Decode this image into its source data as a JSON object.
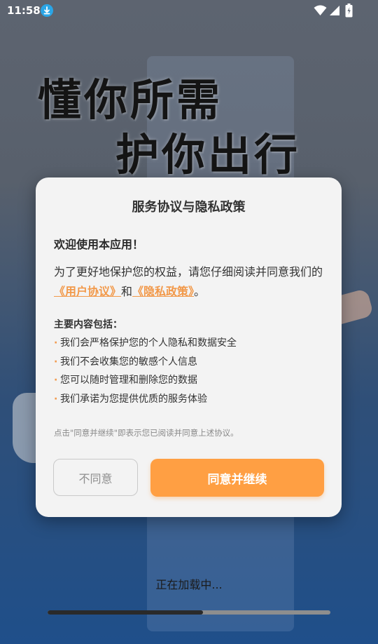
{
  "status_bar": {
    "time": "11:58",
    "icons": [
      "download-icon",
      "wifi-icon",
      "signal-icon",
      "battery-icon"
    ]
  },
  "hero": {
    "line1": "懂你所需",
    "line2": "护你出行"
  },
  "dialog": {
    "title": "服务协议与隐私政策",
    "welcome": "欢迎使用本应用！",
    "intro_prefix": "为了更好地保护您的权益，请您仔细阅读并同意我们的",
    "user_agreement_link": "《用户协议》",
    "and_text": "和",
    "privacy_policy_link": "《隐私政策》",
    "intro_suffix": "。",
    "section_title": "主要内容包括：",
    "bullets": [
      "我们会严格保护您的个人隐私和数据安全",
      "我们不会收集您的敏感个人信息",
      "您可以随时管理和删除您的数据",
      "我们承诺为您提供优质的服务体验"
    ],
    "notice": "点击\"同意并继续\"即表示您已阅读并同意上述协议。",
    "disagree_label": "不同意",
    "agree_label": "同意并继续"
  },
  "loading": {
    "text": "正在加载中...",
    "progress": 0.55
  },
  "colors": {
    "accent": "#ff9f43",
    "link": "#f2994a",
    "dialog_bg": "#f3f3f3"
  }
}
